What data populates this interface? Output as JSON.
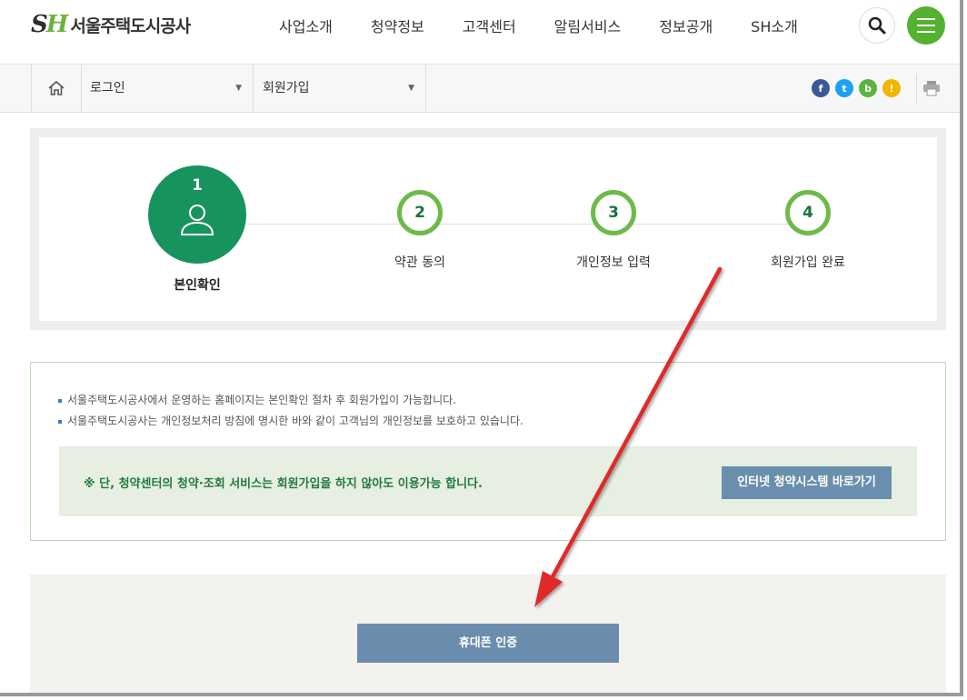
{
  "header": {
    "logo_mark_s": "S",
    "logo_mark_h": "H",
    "logo_text": "서울주택도시공사",
    "nav": [
      "사업소개",
      "청약정보",
      "고객센터",
      "알림서비스",
      "정보공개",
      "SH소개"
    ],
    "search_icon": "search-icon",
    "menu_icon": "hamburger-menu-icon",
    "brand_color": "#55b130"
  },
  "breadcrumb": {
    "home_icon": "home-icon",
    "level1": "로그인",
    "level2": "회원가입",
    "sns": [
      {
        "name": "facebook",
        "glyph": "f",
        "color": "#3b5998"
      },
      {
        "name": "twitter",
        "glyph": "t",
        "color": "#1da1f2"
      },
      {
        "name": "band",
        "glyph": "b",
        "color": "#5ab43d"
      },
      {
        "name": "kakaostory",
        "glyph": "!",
        "color": "#f2b600"
      }
    ],
    "print_icon": "print-icon"
  },
  "steps": [
    {
      "number": "1",
      "label": "본인확인",
      "active": true
    },
    {
      "number": "2",
      "label": "약관 동의",
      "active": false
    },
    {
      "number": "3",
      "label": "개인정보 입력",
      "active": false
    },
    {
      "number": "4",
      "label": "회원가입 완료",
      "active": false
    }
  ],
  "info": {
    "lines": [
      "서울주택도시공사에서 운영하는 홈페이지는 본인확인 절차 후 회원가입이 가능합니다.",
      "서울주택도시공사는 개인정보처리 방침에 명시한 바와 같이 고객님의 개인정보를 보호하고 있습니다."
    ],
    "note": "※ 단, 청약센터의 청약·조회 서비스는 회원가입을 하지 않아도 이용가능 합니다.",
    "note_button": "인터넷 청약시스템 바로가기"
  },
  "verify": {
    "phone_button": "휴대폰 인증"
  },
  "colors": {
    "step_active": "#17935d",
    "step_ring": "#6dba49",
    "button": "#6a8dad",
    "arrow": "#e02b2b"
  }
}
